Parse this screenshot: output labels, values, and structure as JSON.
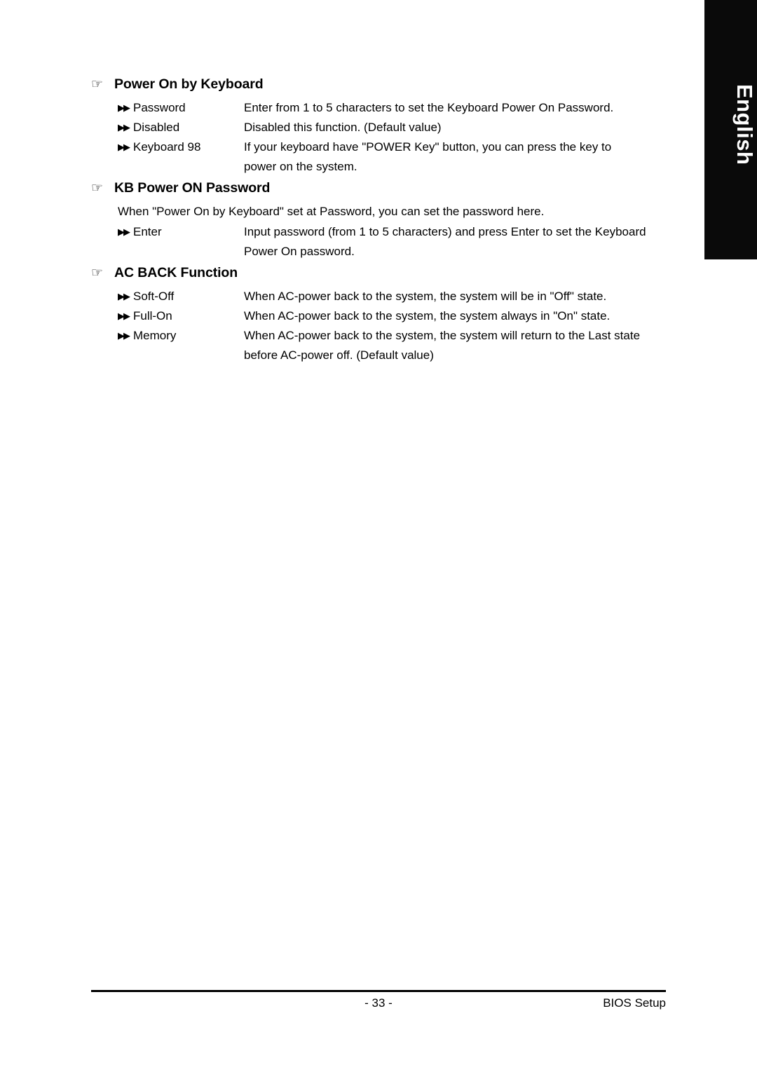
{
  "language_tab": {
    "label": "English"
  },
  "sections": [
    {
      "icon": "pointing-hand-icon",
      "title": "Power On by Keyboard",
      "note": "",
      "options": [
        {
          "bullet": "double-triangle-icon",
          "label": "Password",
          "desc": "Enter from 1 to 5 characters to set the Keyboard Power On Password.",
          "desc_cont": ""
        },
        {
          "bullet": "double-triangle-icon",
          "label": "Disabled",
          "desc": "Disabled this function. (Default value)",
          "desc_cont": ""
        },
        {
          "bullet": "double-triangle-icon",
          "label": "Keyboard 98",
          "desc": "If your keyboard have \"POWER Key\" button, you can press the key to",
          "desc_cont": "power on the system."
        }
      ]
    },
    {
      "icon": "pointing-hand-icon",
      "title": "KB Power ON Password",
      "note": "When \"Power On by Keyboard\" set at Password, you can set the password here.",
      "options": [
        {
          "bullet": "double-triangle-icon",
          "label": "Enter",
          "desc": "Input password (from 1 to 5 characters) and press Enter to set the Keyboard",
          "desc_cont": "Power On password."
        }
      ]
    },
    {
      "icon": "pointing-hand-icon",
      "title": "AC BACK Function",
      "note": "",
      "options": [
        {
          "bullet": "double-triangle-icon",
          "label": "Soft-Off",
          "desc": "When AC-power back to the system, the system will be in \"Off\" state.",
          "desc_cont": ""
        },
        {
          "bullet": "double-triangle-icon",
          "label": "Full-On",
          "desc": "When AC-power back to the system, the system always in \"On\" state.",
          "desc_cont": ""
        },
        {
          "bullet": "double-triangle-icon",
          "label": "Memory",
          "desc": "When AC-power back to the system, the system will return to the Last state",
          "desc_cont": "before AC-power off. (Default value)"
        }
      ]
    }
  ],
  "footer": {
    "page_number": "- 33 -",
    "right_label": "BIOS Setup"
  },
  "glyphs": {
    "hand": "☞",
    "double_triangle": "▶▶"
  }
}
